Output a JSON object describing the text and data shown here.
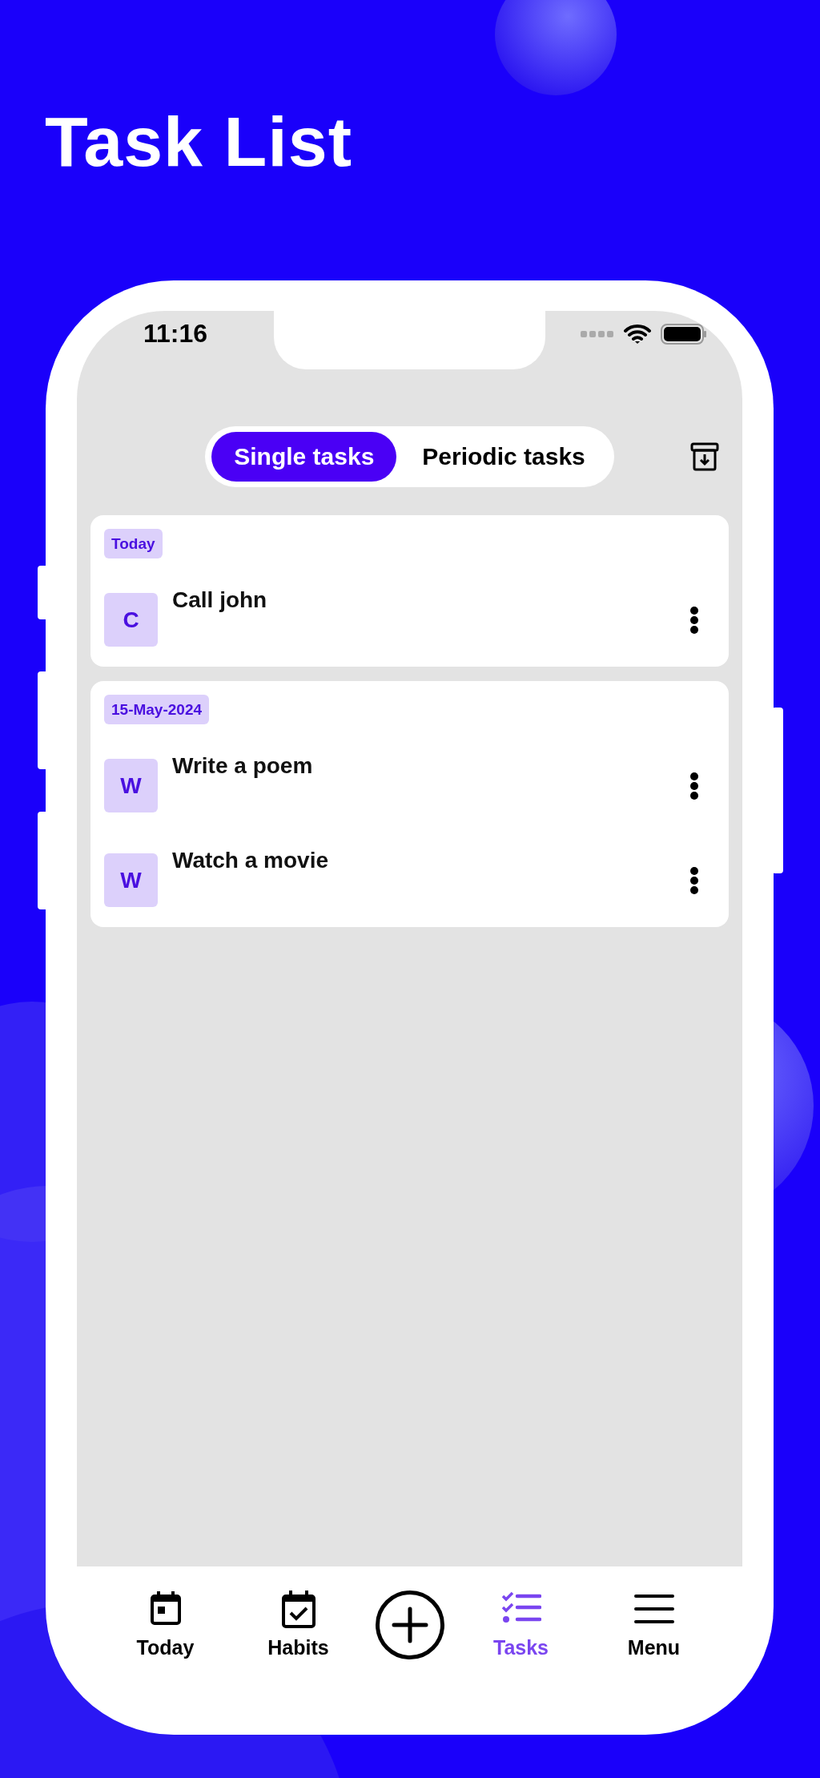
{
  "title": "Task List",
  "status_bar": {
    "time": "11:16"
  },
  "segments": [
    {
      "label": "Single tasks",
      "selected": true
    },
    {
      "label": "Periodic tasks",
      "selected": false
    }
  ],
  "groups": [
    {
      "label": "Today",
      "tasks": [
        {
          "initial": "C",
          "title": "Call john"
        }
      ]
    },
    {
      "label": "15-May-2024",
      "tasks": [
        {
          "initial": "W",
          "title": "Write a poem"
        },
        {
          "initial": "W",
          "title": "Watch a movie"
        }
      ]
    }
  ],
  "nav": [
    {
      "kind": "today",
      "label": "Today",
      "selected": false
    },
    {
      "kind": "habits",
      "label": "Habits",
      "selected": false
    },
    {
      "kind": "add",
      "selected": false
    },
    {
      "kind": "tasks",
      "label": "Tasks",
      "selected": true
    },
    {
      "kind": "menu",
      "label": "Menu",
      "selected": false
    }
  ]
}
